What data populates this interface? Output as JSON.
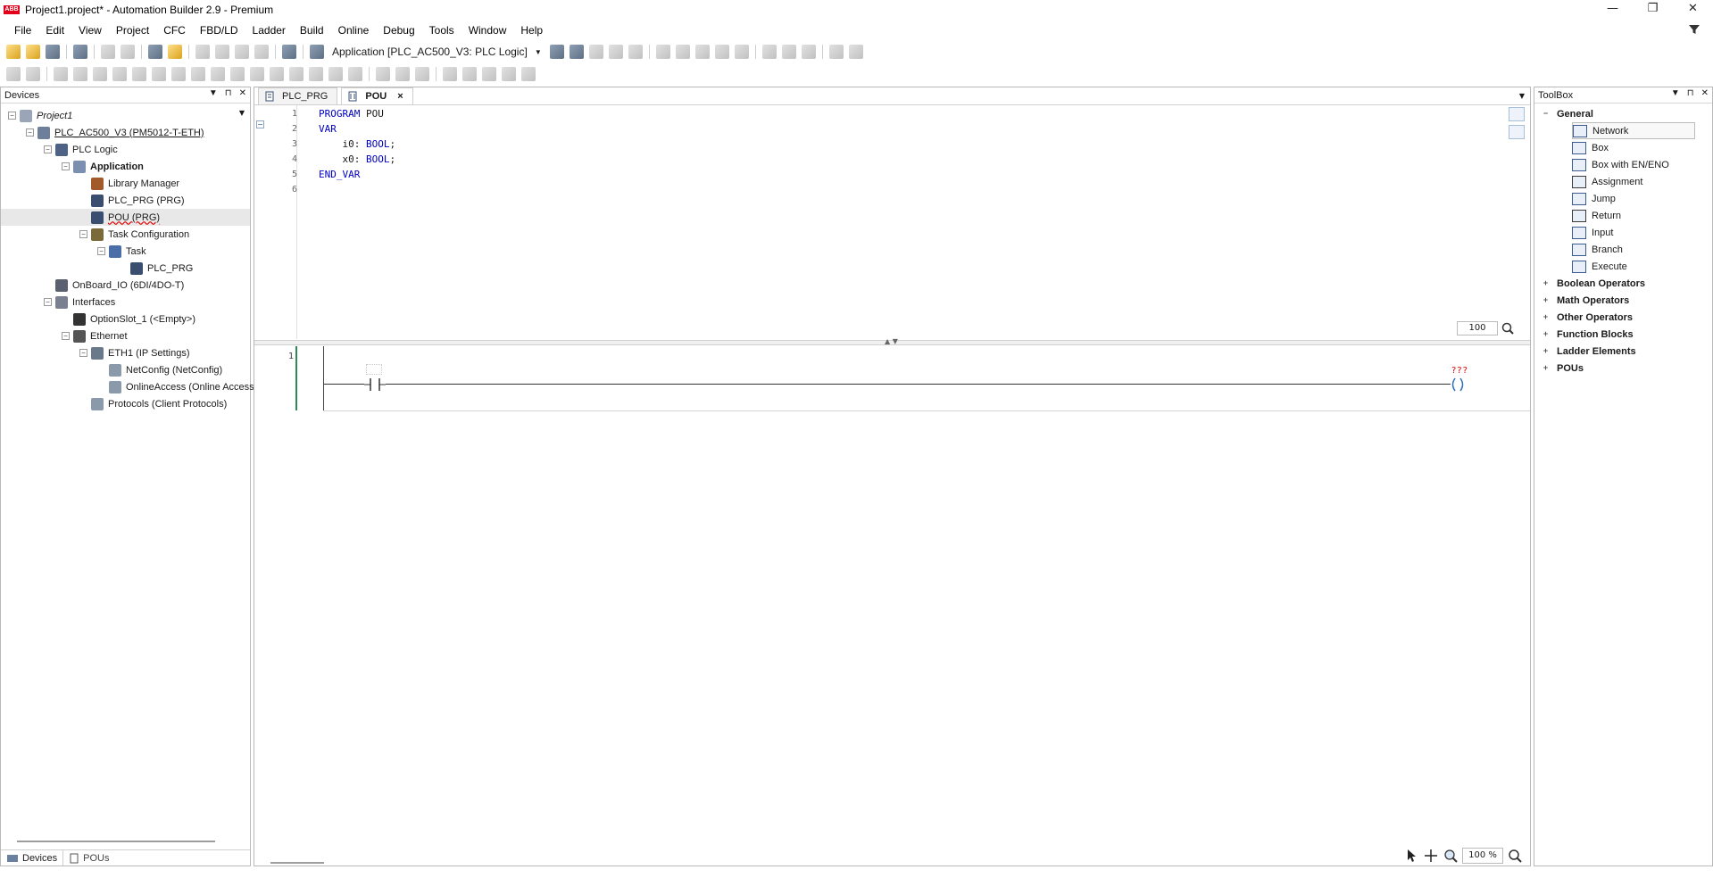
{
  "window": {
    "title": "Project1.project* - Automation Builder 2.9 - Premium",
    "logo_text": "ABB",
    "minimize": "—",
    "maximize": "❐",
    "close": "✕"
  },
  "menu": [
    "File",
    "Edit",
    "View",
    "Project",
    "CFC",
    "FBD/LD",
    "Ladder",
    "Build",
    "Online",
    "Debug",
    "Tools",
    "Window",
    "Help"
  ],
  "toolbar": {
    "application_combo": "Application [PLC_AC500_V3: PLC Logic]"
  },
  "devices": {
    "title": "Devices",
    "tree": [
      {
        "label": "Project1",
        "italic": true,
        "level": 0,
        "expander": "−"
      },
      {
        "label": "PLC_AC500_V3 (PM5012-T-ETH)",
        "level": 1,
        "expander": "−",
        "underline": true
      },
      {
        "label": "PLC Logic",
        "level": 2,
        "expander": "−"
      },
      {
        "label": "Application",
        "level": 3,
        "expander": "−",
        "bold": true
      },
      {
        "label": "Library Manager",
        "level": 4
      },
      {
        "label": "PLC_PRG (PRG)",
        "level": 4
      },
      {
        "label": "POU (PRG)",
        "level": 4,
        "selected": true,
        "squiggle": true
      },
      {
        "label": "Task Configuration",
        "level": 4,
        "expander": "−"
      },
      {
        "label": "Task",
        "level": 5,
        "expander": "−"
      },
      {
        "label": "PLC_PRG",
        "level": 6
      },
      {
        "label": "OnBoard_IO (6DI/4DO-T)",
        "level": 2
      },
      {
        "label": "Interfaces",
        "level": 2,
        "expander": "−"
      },
      {
        "label": "OptionSlot_1 (<Empty>)",
        "level": 3
      },
      {
        "label": "Ethernet",
        "level": 3,
        "expander": "−"
      },
      {
        "label": "ETH1 (IP Settings)",
        "level": 4,
        "expander": "−"
      },
      {
        "label": "NetConfig (NetConfig)",
        "level": 5
      },
      {
        "label": "OnlineAccess (Online Access",
        "level": 5
      },
      {
        "label": "Protocols (Client Protocols)",
        "level": 4
      }
    ],
    "bottom_tabs": [
      "Devices",
      "POUs"
    ]
  },
  "editor": {
    "tabs": [
      {
        "label": "PLC_PRG",
        "active": false
      },
      {
        "label": "POU",
        "active": true
      }
    ],
    "close_glyph": "×",
    "declaration": [
      {
        "num": "1",
        "keyword": "PROGRAM",
        "rest": " POU"
      },
      {
        "num": "2",
        "keyword": "VAR",
        "rest": ""
      },
      {
        "num": "3",
        "keyword": "",
        "rest": "    i0: ",
        "type": "BOOL",
        "end": ";"
      },
      {
        "num": "4",
        "keyword": "",
        "rest": "    x0: ",
        "type": "BOOL",
        "end": ";"
      },
      {
        "num": "5",
        "keyword": "END_VAR",
        "rest": ""
      },
      {
        "num": "6",
        "keyword": "",
        "rest": ""
      }
    ],
    "decl_zoom": "100",
    "network_number": "1",
    "coil_variable": "???",
    "body_zoom": "100 %"
  },
  "toolbox": {
    "title": "ToolBox",
    "categories": [
      {
        "label": "General",
        "expanded": true,
        "items": [
          "Network",
          "Box",
          "Box with EN/ENO",
          "Assignment",
          "Jump",
          "Return",
          "Input",
          "Branch",
          "Execute"
        ]
      },
      {
        "label": "Boolean Operators",
        "expanded": false
      },
      {
        "label": "Math Operators",
        "expanded": false
      },
      {
        "label": "Other Operators",
        "expanded": false
      },
      {
        "label": "Function Blocks",
        "expanded": false
      },
      {
        "label": "Ladder Elements",
        "expanded": false
      },
      {
        "label": "POUs",
        "expanded": false
      }
    ]
  },
  "colors": {
    "keyword": "#0000c8",
    "network_bar": "#2e8b57",
    "unassigned_var": "#e00000",
    "brand": "#e2001a"
  }
}
